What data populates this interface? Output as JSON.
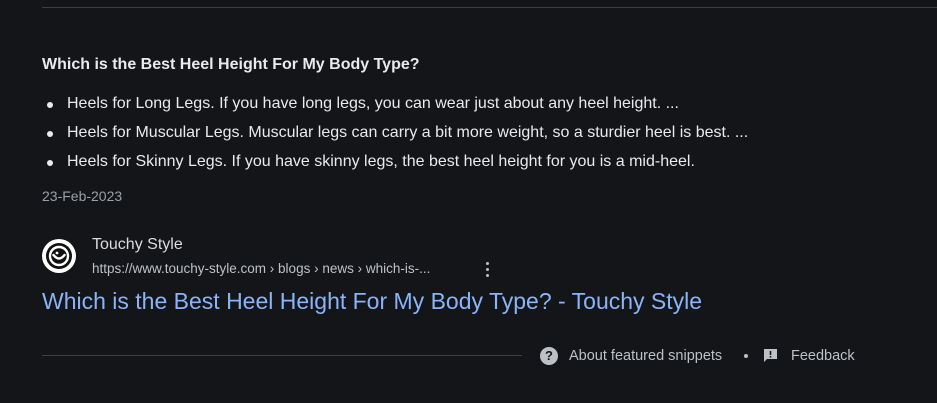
{
  "snippet": {
    "heading": "Which is the Best Heel Height For My Body Type?",
    "bullets": [
      "Heels for Long Legs. If you have long legs, you can wear just about any heel height. ...",
      "Heels for Muscular Legs. Muscular legs can carry a bit more weight, so a sturdier heel is best. ...",
      "Heels for Skinny Legs. If you have skinny legs, the best heel height for you is a mid-heel."
    ],
    "date": "23-Feb-2023"
  },
  "source": {
    "site_name": "Touchy Style",
    "url": "https://www.touchy-style.com › blogs › news › which-is-...",
    "favicon_icon": "touchy-style-logo-icon",
    "more_icon": "more-vert-icon"
  },
  "result": {
    "title": "Which is the Best Heel Height For My Body Type? - Touchy Style"
  },
  "footer": {
    "about_label": "About featured snippets",
    "about_icon": "help-circle-icon",
    "separator": "•",
    "feedback_label": "Feedback",
    "feedback_icon": "feedback-icon"
  },
  "colors": {
    "background": "#141519",
    "text": "#e8eaed",
    "secondary_text": "#9aa0a6",
    "link": "#8ab4f8",
    "divider": "#3c4043"
  }
}
